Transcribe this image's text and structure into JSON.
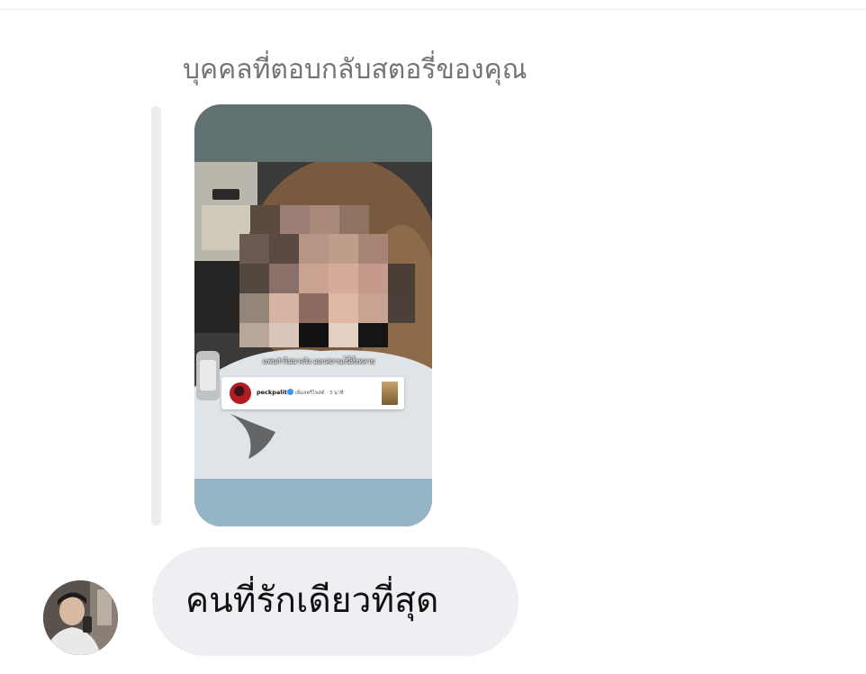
{
  "thread": {
    "story_reply_caption": "บุคคลที่ตอบกลับสตอรี่ของคุณ",
    "story": {
      "overlay_caption": "แฟนกำไม่มาจริง ออกสถานะ์นี้ทั้งหลาย",
      "shared_post": {
        "username": "peckpalit",
        "verified_icon": "verified-badge-icon",
        "meta": "เพิ่มสตรีโพสต์ · 3 นาที"
      }
    },
    "message": {
      "text": "คนที่รักเดียวที่สุด"
    },
    "sender_avatar_icon": "user-avatar"
  },
  "colors": {
    "bubble_background": "#efeff3",
    "caption_text": "#737378",
    "message_text": "#111111",
    "reply_bar": "#ededf0"
  }
}
